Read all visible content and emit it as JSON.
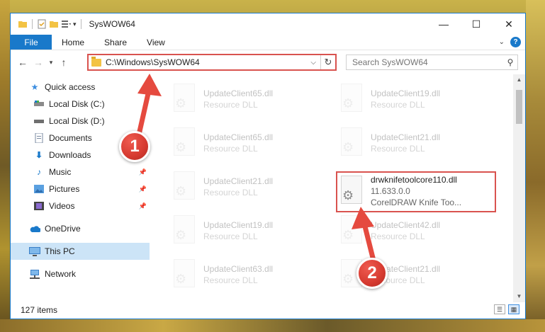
{
  "window": {
    "title": "SysWOW64",
    "controls": {
      "minimize": "—",
      "maximize": "☐",
      "close": "✕"
    }
  },
  "ribbon": {
    "tabs": [
      "File",
      "Home",
      "Share",
      "View"
    ],
    "help": "?"
  },
  "navigation": {
    "address": "C:\\Windows\\SysWOW64",
    "search_placeholder": "Search SysWOW64"
  },
  "sidebar": {
    "items": [
      {
        "label": "Quick access",
        "icon": "star-icon",
        "pinned": false
      },
      {
        "label": "Local Disk (C:)",
        "icon": "drive-icon",
        "pinned": false
      },
      {
        "label": "Local Disk (D:)",
        "icon": "drive-icon",
        "pinned": false
      },
      {
        "label": "Documents",
        "icon": "documents-icon",
        "pinned": false
      },
      {
        "label": "Downloads",
        "icon": "download-icon",
        "pinned": true
      },
      {
        "label": "Music",
        "icon": "music-icon",
        "pinned": true
      },
      {
        "label": "Pictures",
        "icon": "pictures-icon",
        "pinned": true
      },
      {
        "label": "Videos",
        "icon": "videos-icon",
        "pinned": true
      },
      {
        "label": "OneDrive",
        "icon": "cloud-icon",
        "pinned": false
      },
      {
        "label": "This PC",
        "icon": "computer-icon",
        "pinned": false,
        "selected": true
      },
      {
        "label": "Network",
        "icon": "network-icon",
        "pinned": false
      }
    ]
  },
  "files": [
    {
      "name": "UpdateClient65.dll",
      "sub": "Resource DLL",
      "faded": true
    },
    {
      "name": "UpdateClient19.dll",
      "sub": "Resource DLL",
      "faded": true
    },
    {
      "name": "UpdateClient65.dll",
      "sub": "Resource DLL",
      "faded": true
    },
    {
      "name": "UpdateClient21.dll",
      "sub": "Resource DLL",
      "faded": true
    },
    {
      "name": "UpdateClient21.dll",
      "sub": "Resource DLL",
      "faded": true
    },
    {
      "name": "drwknifetoolcore110.dll",
      "sub": "11.633.0.0",
      "sub2": "CorelDRAW Knife Too...",
      "faded": false
    },
    {
      "name": "UpdateClient19.dll",
      "sub": "Resource DLL",
      "faded": true
    },
    {
      "name": "UpdateClient42.dll",
      "sub": "Resource DLL",
      "faded": true
    },
    {
      "name": "UpdateClient63.dll",
      "sub": "Resource DLL",
      "faded": true
    },
    {
      "name": "UpdateClient21.dll",
      "sub": "Resource DLL",
      "faded": true
    }
  ],
  "status": {
    "count": "127 items"
  },
  "annotations": {
    "callout1": "1",
    "callout2": "2"
  },
  "colors": {
    "accent": "#1979ca",
    "highlight": "#d9534f",
    "selected": "#cce4f7"
  }
}
